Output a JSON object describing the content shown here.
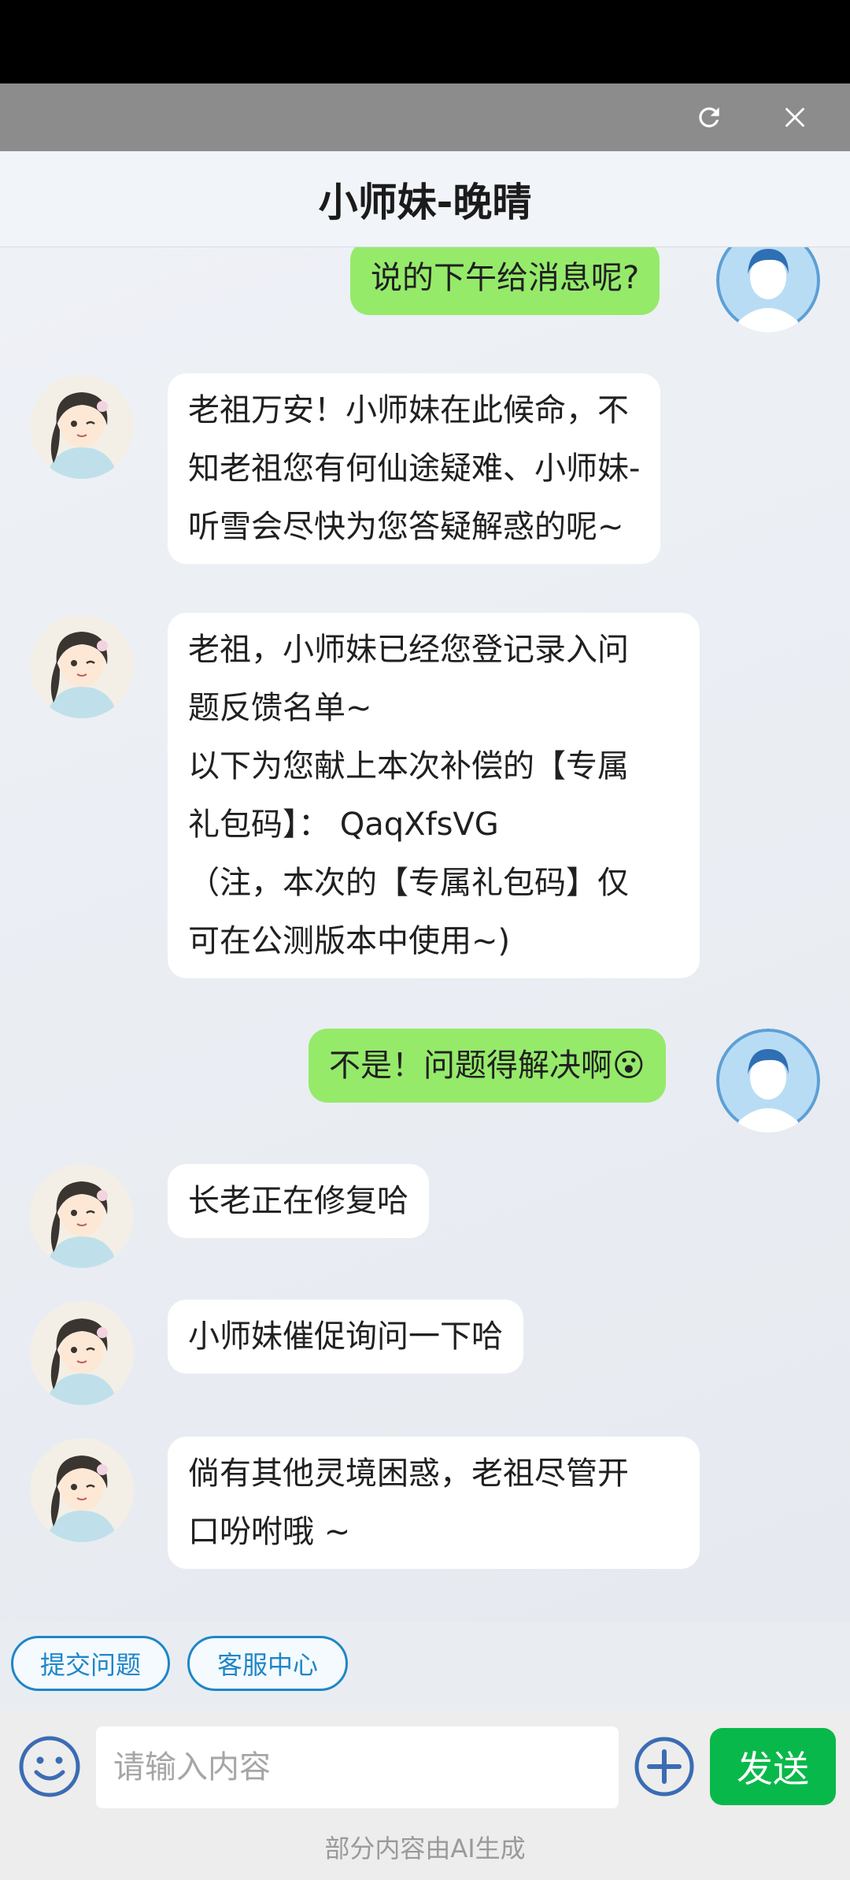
{
  "webview": {
    "refresh_icon": "refresh-icon",
    "close_icon": "close-icon"
  },
  "header": {
    "title": "小师妹-晚晴"
  },
  "messages": [
    {
      "from": "user",
      "text": "说的下午给消息呢?"
    },
    {
      "from": "bot",
      "lines": [
        "老祖万安！小师妹在此候命，不",
        "知老祖您有何仙途疑难、小师妹-",
        "听雪会尽快为您答疑解惑的呢~"
      ]
    },
    {
      "from": "bot",
      "lines": [
        "老祖，小师妹已经您登记录入问",
        "题反馈名单~",
        "以下为您献上本次补偿的【专属",
        "礼包码】：  QaqXfsVG",
        "（注，本次的【专属礼包码】仅",
        "可在公测版本中使用~)"
      ]
    },
    {
      "from": "user",
      "text": "不是！问题得解决啊😮"
    },
    {
      "from": "bot",
      "text": "长老正在修复哈"
    },
    {
      "from": "bot",
      "text": "小师妹催促询问一下哈"
    },
    {
      "from": "bot",
      "lines": [
        "倘有其他灵境困惑，老祖尽管开",
        "口吩咐哦 ~"
      ]
    }
  ],
  "quick_actions": [
    {
      "label": "提交问题"
    },
    {
      "label": "客服中心"
    }
  ],
  "input": {
    "placeholder": "请输入内容",
    "value": "",
    "send_label": "发送"
  },
  "footer": {
    "note": "部分内容由AI生成"
  },
  "colors": {
    "user_bubble": "#95ea6a",
    "send_button": "#09b84a",
    "quick_border": "#1f86c8"
  }
}
